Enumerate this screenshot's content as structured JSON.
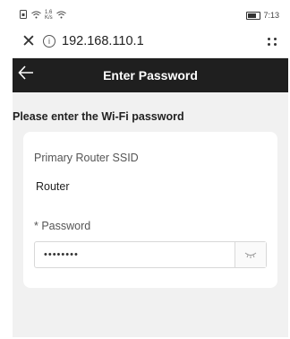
{
  "status_bar": {
    "left_icons": [
      "sim-icon",
      "wifi-icon",
      "data-speed-icon",
      "wifi-icon"
    ],
    "speed_text": "1.6\nK/s",
    "time": "7:13"
  },
  "browser": {
    "url": "192.168.110.1"
  },
  "header": {
    "title": "Enter Password"
  },
  "main": {
    "prompt": "Please enter the Wi-Fi password",
    "ssid_label": "Primary Router SSID",
    "ssid_value": "Router",
    "password_label": "* Password",
    "password_value": "••••••••"
  },
  "colors": {
    "header_bg": "#1f1f1f",
    "content_bg": "#f1f1f1"
  }
}
